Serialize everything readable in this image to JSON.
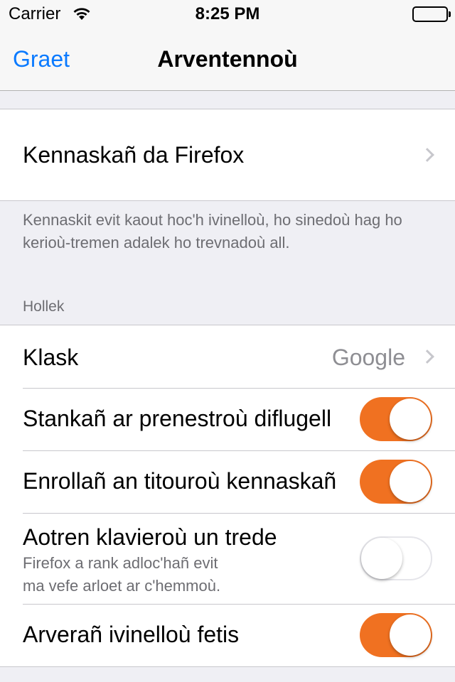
{
  "status_bar": {
    "carrier": "Carrier",
    "time": "8:25 PM"
  },
  "nav": {
    "back_label": "Graet",
    "title": "Arventennoù"
  },
  "sync": {
    "label": "Kennaskañ da Firefox",
    "footer": "Kennaskit evit kaout hoc'h ivinelloù, ho sinedoù hag ho kerioù-tremen adalek ho trevnadoù all."
  },
  "general": {
    "header": "Hollek",
    "rows": [
      {
        "label": "Klask",
        "value": "Google"
      },
      {
        "label": "Stankañ ar prenestroù diflugell",
        "toggle": true
      },
      {
        "label": "Enrollañ an titouroù kennaskañ",
        "toggle": true
      },
      {
        "label": "Aotren klavieroù un trede",
        "sub1": "Firefox a rank adloc'hañ evit",
        "sub2": "ma vefe arloet ar c'hemmoù.",
        "toggle": false
      },
      {
        "label": "Arverañ ivinelloù fetis",
        "toggle": true
      }
    ]
  },
  "colors": {
    "accent": "#f07121",
    "link": "#0a7aff"
  }
}
